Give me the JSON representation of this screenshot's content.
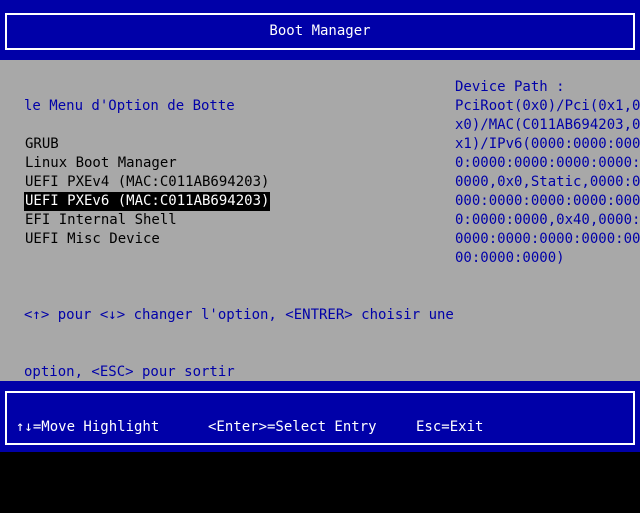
{
  "colors": {
    "blue": "#0000a8",
    "gray": "#a8a8a8",
    "white": "#ffffff",
    "black": "#000000"
  },
  "header": {
    "title": "Boot Manager"
  },
  "menu": {
    "title": "le Menu d'Option de Botte",
    "items": [
      {
        "label": "GRUB",
        "selected": false
      },
      {
        "label": "Linux Boot Manager",
        "selected": false
      },
      {
        "label": "UEFI PXEv4 (MAC:C011AB694203)",
        "selected": false
      },
      {
        "label": "UEFI PXEv6 (MAC:C011AB694203)",
        "selected": true
      },
      {
        "label": "EFI Internal Shell",
        "selected": false
      },
      {
        "label": "UEFI Misc Device",
        "selected": false
      }
    ],
    "help_line1": "<↑> pour <↓> changer l'option, <ENTRER> choisir une",
    "help_line2": "option, <ESC> pour sortir"
  },
  "device_path": {
    "lines": [
      "Device Path :",
      "PciRoot(0x0)/Pci(0x1,0",
      "x0)/MAC(C011AB694203,0",
      "x1)/IPv6(0000:0000:000",
      "0:0000:0000:0000:0000:",
      "0000,0x0,Static,0000:0",
      "000:0000:0000:0000:000",
      "0:0000:0000,0x40,0000:",
      "0000:0000:0000:0000:00",
      "00:0000:0000)"
    ]
  },
  "footer": {
    "move": "↑↓=Move Highlight",
    "select": "<Enter>=Select Entry",
    "exit": "Esc=Exit"
  }
}
